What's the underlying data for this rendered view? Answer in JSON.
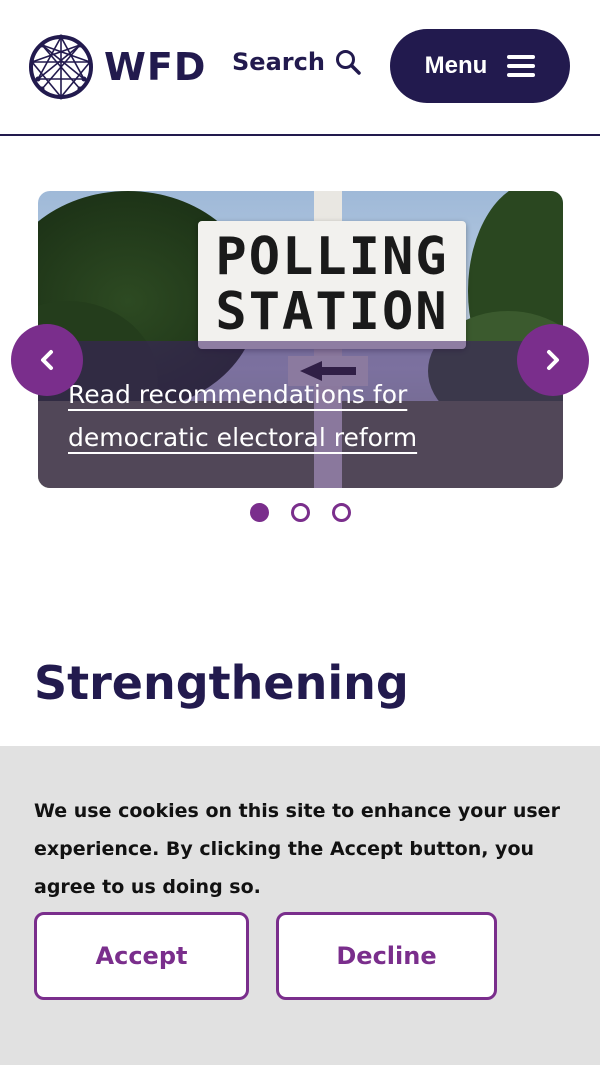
{
  "header": {
    "logo_text": "WFD",
    "search_label": "Search",
    "menu_label": "Menu"
  },
  "carousel": {
    "slides": [
      {
        "sign_line1": "POLLING",
        "sign_line2": "STATION",
        "link_text": "Read recommendations for democratic electoral reform"
      }
    ],
    "active_index": 0,
    "dot_count": 3
  },
  "main": {
    "heading": "Strengthening"
  },
  "cookie_banner": {
    "message": "We use cookies on this site to enhance your user experience. By clicking the Accept button, you agree to us doing so.",
    "accept_label": "Accept",
    "decline_label": "Decline"
  },
  "colors": {
    "navy": "#221a4e",
    "purple": "#7a2e8c",
    "banner_bg": "#e1e1e1"
  },
  "icons": {
    "logo": "globe-network-icon",
    "search": "search-icon",
    "menu": "hamburger-icon",
    "prev": "chevron-left-icon",
    "next": "chevron-right-icon"
  }
}
